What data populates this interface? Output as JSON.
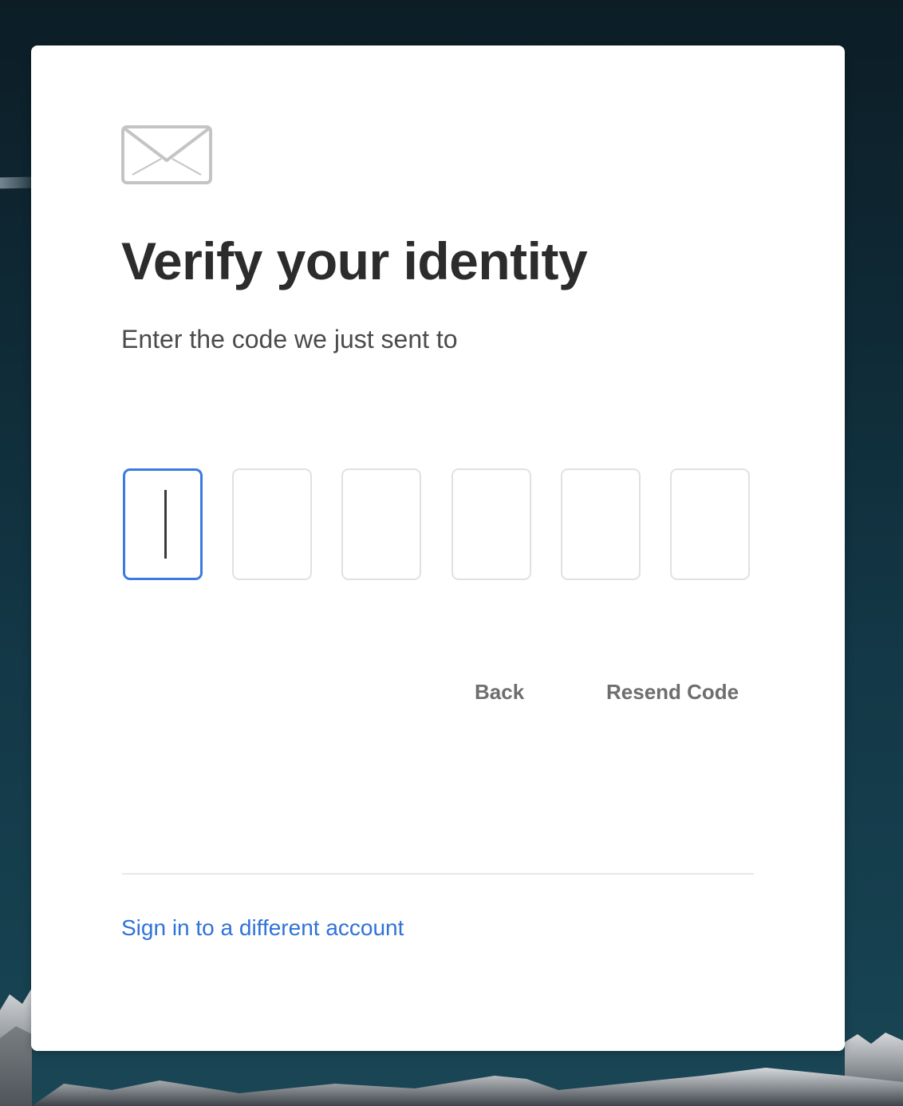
{
  "page": {
    "title": "Verify your identity",
    "subtitle": "Enter the code we just sent to"
  },
  "code_input": {
    "digits": [
      "",
      "",
      "",
      "",
      "",
      ""
    ],
    "active_index": 0
  },
  "actions": {
    "back_label": "Back",
    "resend_label": "Resend Code"
  },
  "footer": {
    "switch_account_label": "Sign in to a different account"
  },
  "icons": {
    "header_icon": "mail-envelope-icon"
  },
  "colors": {
    "accent": "#3b7be0",
    "link": "#2f72d8",
    "title": "#2c2c2c",
    "secondary_text": "#6e6e6e",
    "card_background": "#ffffff"
  }
}
